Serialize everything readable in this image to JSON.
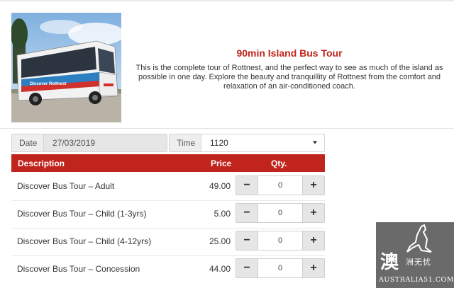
{
  "tour": {
    "title": "90min Island Bus Tour",
    "description": "This is the complete tour of Rottnest, and the perfect way to see as much of the island as possible in one day. Explore the beauty and tranquillity of Rottnest from the comfort and relaxation of an air-conditioned coach.",
    "bus_livery_text": "Discover Rottnest"
  },
  "booking": {
    "date_label": "Date",
    "date_value": "27/03/2019",
    "time_label": "Time",
    "time_value": "1120"
  },
  "table": {
    "headers": {
      "description": "Description",
      "price": "Price",
      "qty": "Qty."
    },
    "rows": [
      {
        "description": "Discover Bus Tour – Adult",
        "price": "49.00",
        "qty": "0",
        "minus": "−",
        "plus": "+"
      },
      {
        "description": "Discover Bus Tour – Child (1-3yrs)",
        "price": "5.00",
        "qty": "0",
        "minus": "−",
        "plus": "+"
      },
      {
        "description": "Discover Bus Tour – Child (4-12yrs)",
        "price": "25.00",
        "qty": "0",
        "minus": "−",
        "plus": "+"
      },
      {
        "description": "Discover Bus Tour – Concession",
        "price": "44.00",
        "qty": "0",
        "minus": "−",
        "plus": "+"
      }
    ]
  },
  "watermark": {
    "glyph": "澳",
    "sub": "洲无忧",
    "brand": "AUSTRALIA51.COM"
  },
  "colors": {
    "accent": "#c0241c"
  }
}
